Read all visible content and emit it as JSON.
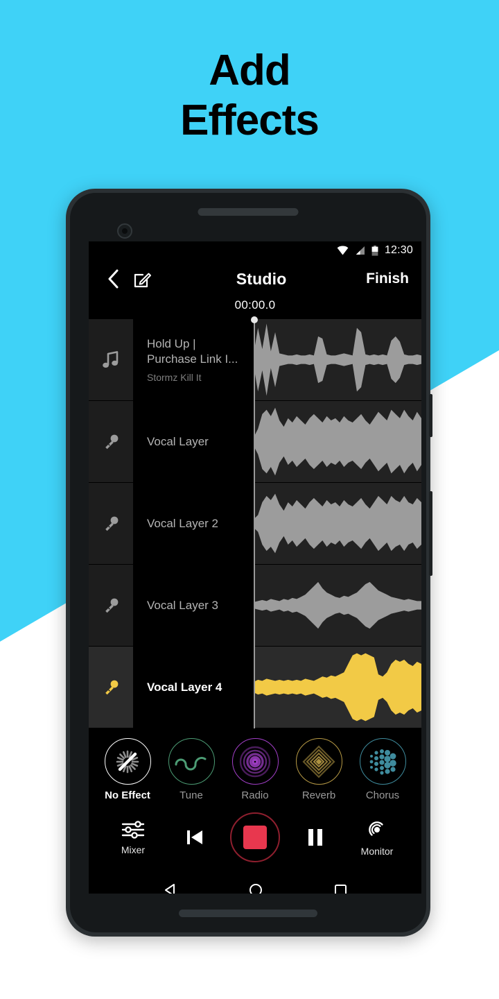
{
  "promo": {
    "heading_line1": "Add",
    "heading_line2": "Effects",
    "background_color": "#3fd2f7",
    "wedge_color": "#ffffff"
  },
  "status_bar": {
    "time": "12:30",
    "icons": [
      "wifi-icon",
      "cellular-signal-icon",
      "battery-icon"
    ]
  },
  "app_bar": {
    "back_icon": "chevron-left-icon",
    "edit_icon": "edit-pencil-icon",
    "title": "Studio",
    "finish_label": "Finish",
    "timecode": "00:00.0"
  },
  "tracks": [
    {
      "icon": "music-note-icon",
      "title": "Hold Up | Purchase Link I...",
      "subtitle": "Stormz Kill It",
      "selected": false,
      "wave_color": "#9c9c9c",
      "wave": [
        6,
        30,
        10,
        34,
        8,
        26,
        6,
        5,
        4,
        4,
        5,
        4,
        4,
        5,
        4,
        22,
        20,
        5,
        4,
        4,
        5,
        6,
        5,
        4,
        30,
        26,
        5,
        4,
        5,
        4,
        5,
        4,
        18,
        22,
        17,
        5,
        4,
        4,
        5,
        4
      ]
    },
    {
      "icon": "microphone-icon",
      "title": "Vocal Layer",
      "subtitle": "",
      "selected": false,
      "wave_color": "#9c9c9c",
      "wave": [
        4,
        12,
        26,
        30,
        24,
        32,
        20,
        14,
        22,
        18,
        24,
        20,
        16,
        22,
        26,
        22,
        18,
        24,
        20,
        22,
        18,
        24,
        20,
        18,
        22,
        26,
        20,
        16,
        22,
        28,
        24,
        20,
        30,
        26,
        22,
        30,
        24,
        20,
        28,
        22
      ]
    },
    {
      "icon": "microphone-icon",
      "title": "Vocal Layer 2",
      "subtitle": "",
      "selected": false,
      "wave_color": "#9c9c9c",
      "wave": [
        4,
        8,
        20,
        26,
        22,
        28,
        18,
        12,
        20,
        16,
        22,
        18,
        14,
        20,
        24,
        20,
        16,
        22,
        18,
        20,
        16,
        22,
        18,
        16,
        20,
        24,
        18,
        14,
        20,
        26,
        22,
        18,
        26,
        22,
        20,
        26,
        20,
        18,
        24,
        20
      ]
    },
    {
      "icon": "microphone-icon",
      "title": "Vocal Layer 3",
      "subtitle": "",
      "selected": false,
      "wave_color": "#9c9c9c",
      "wave": [
        3,
        4,
        5,
        4,
        6,
        5,
        4,
        6,
        5,
        7,
        6,
        8,
        10,
        14,
        18,
        22,
        16,
        12,
        10,
        8,
        7,
        9,
        8,
        10,
        12,
        16,
        20,
        22,
        18,
        14,
        12,
        10,
        8,
        7,
        6,
        5,
        6,
        5,
        4,
        4
      ]
    },
    {
      "icon": "microphone-icon",
      "title": "Vocal Layer 4",
      "subtitle": "",
      "selected": true,
      "wave_color": "#f2ca46",
      "wave": [
        5,
        7,
        6,
        8,
        7,
        6,
        7,
        6,
        7,
        6,
        7,
        6,
        8,
        7,
        6,
        8,
        10,
        9,
        11,
        10,
        12,
        14,
        22,
        30,
        32,
        30,
        32,
        30,
        28,
        12,
        10,
        14,
        22,
        26,
        24,
        26,
        22,
        20,
        24,
        22
      ]
    }
  ],
  "effects": [
    {
      "label": "No Effect",
      "icon": "no-effect-starburst-icon",
      "color": "#ffffff",
      "selected": true
    },
    {
      "label": "Tune",
      "icon": "tune-wave-icon",
      "color": "#4c9c74",
      "selected": false
    },
    {
      "label": "Radio",
      "icon": "radio-rings-icon",
      "color": "#a23fc8",
      "selected": false
    },
    {
      "label": "Reverb",
      "icon": "reverb-diamonds-icon",
      "color": "#b79a45",
      "selected": false
    },
    {
      "label": "Chorus",
      "icon": "chorus-dots-icon",
      "color": "#3f8c9e",
      "selected": false
    }
  ],
  "transport": {
    "mixer_label": "Mixer",
    "mixer_icon": "sliders-icon",
    "rewind_icon": "skip-to-start-icon",
    "record_icon": "stop-square-icon",
    "record_color": "#e8374e",
    "pause_icon": "pause-icon",
    "monitor_label": "Monitor",
    "monitor_icon": "monitor-headphone-icon"
  },
  "nav_bar": {
    "back_icon": "android-back-triangle-icon",
    "home_icon": "android-home-circle-icon",
    "recents_icon": "android-recents-square-icon"
  }
}
